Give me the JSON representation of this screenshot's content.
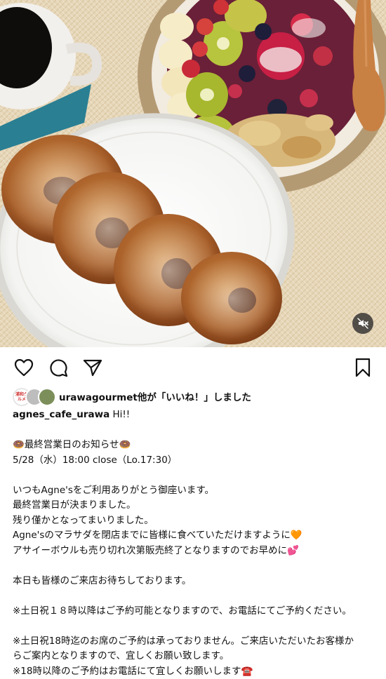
{
  "post": {
    "media": {
      "description_icons": [
        "mute-icon"
      ]
    },
    "actions": {
      "like_icon": "heart-icon",
      "comment_icon": "comment-icon",
      "share_icon": "send-icon",
      "save_icon": "bookmark-icon"
    },
    "likes_text": "urawagourmet他が「いいね！」しました",
    "liker_badge": "浦和グルメ",
    "caption": {
      "username": "agnes_cafe_urawa",
      "first_line_rest": " Hi!!",
      "announce": "🍩最終営業日のお知らせ🍩",
      "date_line": "5/28（水）18:00 close（Lo.17:30）",
      "para1": [
        "いつもAgne'sをご利用ありがとう御座います。",
        "最終営業日が決まりました。",
        "残り僅かとなってまいりました。",
        "Agne'sのマラサダを閉店までに皆様に食べていただけますように🧡",
        "アサイーボウルも売り切れ次第販売終了となりますのでお早めに💕"
      ],
      "para2": "本日も皆様のご来店お待ちしております。",
      "note1": "※土日祝１８時以降はご予約可能となりますので、お電話にてご予約ください。",
      "note2_a": "※土日祝18時迄のお席のご予約は承っておりません。ご来店いただいたお客様か",
      "note2_b": "らご案内となりますので、宜しくお願い致します。",
      "note3": "※18時以降のご予約はお電話にて宜しくお願いします☎️"
    }
  }
}
